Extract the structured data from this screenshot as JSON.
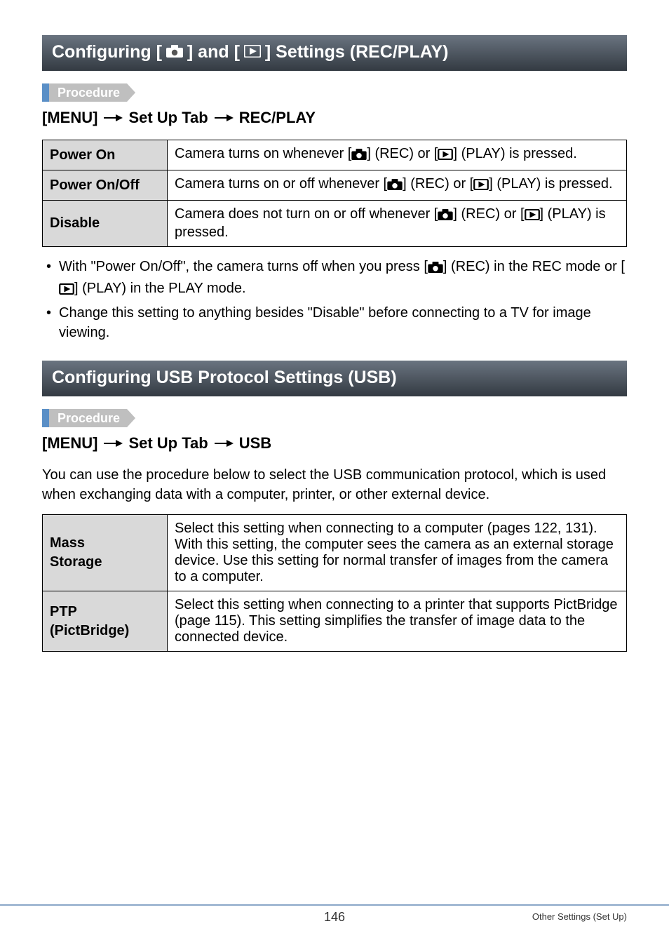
{
  "section1": {
    "title_pre": "Configuring [",
    "title_mid": "] and [",
    "title_post": "] Settings (REC/PLAY)",
    "procedure_label": "Procedure",
    "menu_path": {
      "a": "[MENU]",
      "b": "Set Up Tab",
      "c": "REC/PLAY"
    },
    "rows": [
      {
        "label": "Power On",
        "desc_pre": "Camera turns on whenever [",
        "desc_mid": "] (REC) or [",
        "desc_post": "] (PLAY) is pressed."
      },
      {
        "label": "Power On/Off",
        "desc_pre": "Camera turns on or off whenever [",
        "desc_mid": "] (REC) or [",
        "desc_post": "] (PLAY) is pressed."
      },
      {
        "label": "Disable",
        "desc_pre": "Camera does not turn on or off whenever [",
        "desc_mid": "] (REC) or [",
        "desc_post": "] (PLAY) is pressed."
      }
    ],
    "notes": [
      {
        "pre": "With \"Power On/Off\", the camera turns off when you press [",
        "mid": "] (REC) in the REC mode or [",
        "post": "] (PLAY) in the PLAY mode."
      },
      {
        "text": "Change this setting to anything besides \"Disable\" before connecting to a TV for image viewing."
      }
    ]
  },
  "section2": {
    "title": "Configuring USB Protocol Settings (USB)",
    "procedure_label": "Procedure",
    "menu_path": {
      "a": "[MENU]",
      "b": "Set Up Tab",
      "c": "USB"
    },
    "intro": "You can use the procedure below to select the USB communication protocol, which is used when exchanging data with a computer, printer, or other external device.",
    "rows": [
      {
        "label1": "Mass",
        "label2": "Storage",
        "desc": "Select this setting when connecting to a computer (pages 122, 131). With this setting, the computer sees the camera as an external storage device. Use this setting for normal transfer of images from the camera to a computer."
      },
      {
        "label1": "PTP",
        "label2": "(PictBridge)",
        "desc": "Select this setting when connecting to a printer that supports PictBridge (page 115). This setting simplifies the transfer of image data to the connected device."
      }
    ]
  },
  "footer": {
    "page": "146",
    "right": "Other Settings (Set Up)"
  }
}
